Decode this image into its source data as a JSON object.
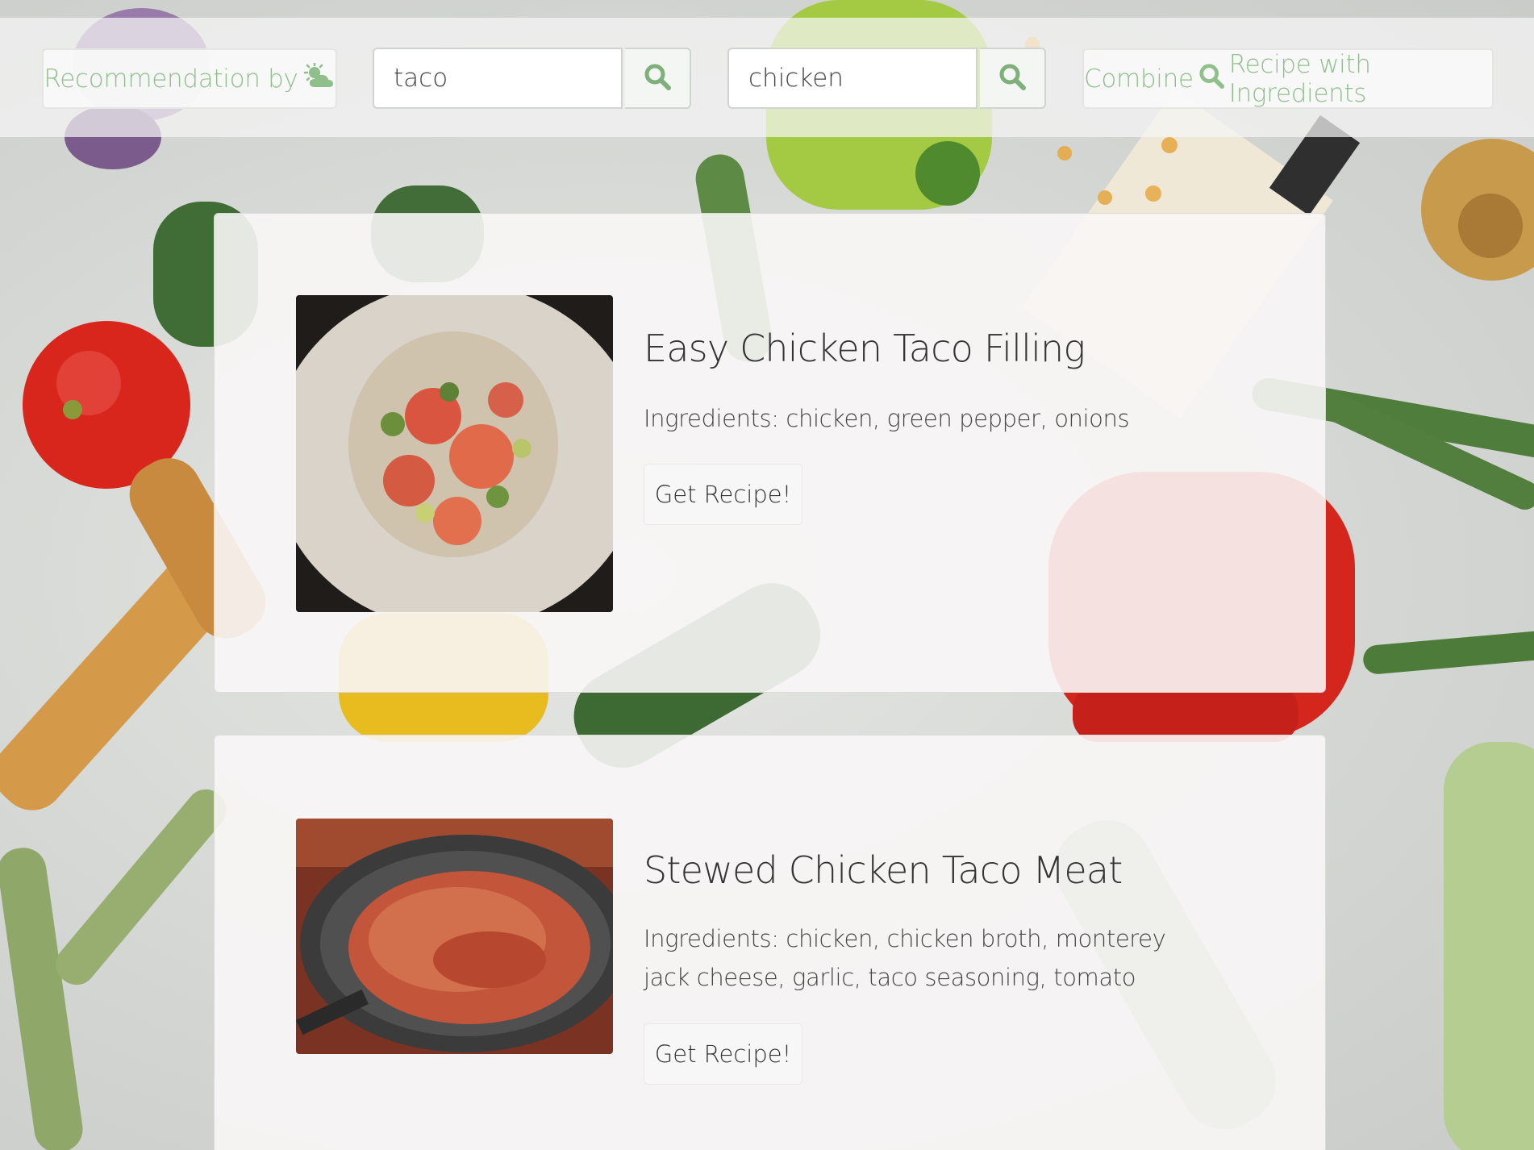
{
  "toolbar": {
    "recommendation_label": "Recommendation by",
    "recommendation_icon": "weather-sun-cloud-icon",
    "search1": {
      "value": "taco",
      "button_icon": "search-icon"
    },
    "search2": {
      "value": "chicken",
      "button_icon": "search-icon"
    },
    "combine_label_before": "Combine",
    "combine_icon": "search-icon",
    "combine_label_after": "Recipe with Ingredients"
  },
  "colors": {
    "accent": "#8fbf8b",
    "search_icon": "#7fb07b"
  },
  "recipes": [
    {
      "title": "Easy Chicken Taco Filling",
      "ingredients": "Ingredients: chicken, green pepper, onions",
      "button_label": "Get Recipe!"
    },
    {
      "title": "Stewed Chicken Taco Meat",
      "ingredients": "Ingredients: chicken, chicken broth, monterey jack cheese, garlic, taco seasoning, tomato",
      "button_label": "Get Recipe!"
    }
  ]
}
